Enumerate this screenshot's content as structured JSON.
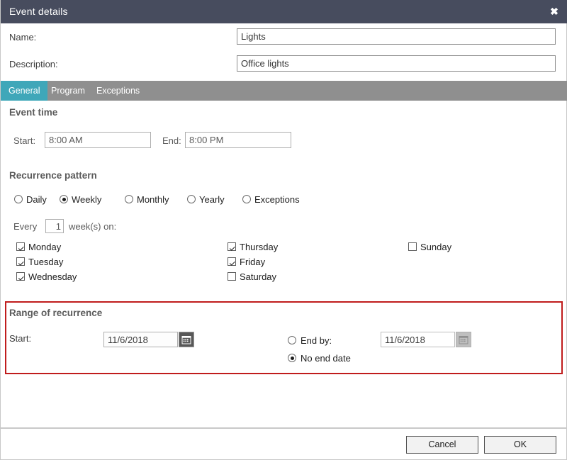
{
  "window": {
    "title": "Event details",
    "close_icon": "close-icon",
    "close_glyph": "✖",
    "header_color": "#474c5e",
    "accent_color": "#3fa7b9",
    "highlight_border_color": "#c01c1c"
  },
  "fields": {
    "name_label": "Name:",
    "name_value": "Lights",
    "name_placeholder": "",
    "description_label": "Description:",
    "description_value": "Office lights",
    "description_placeholder": ""
  },
  "tabs": [
    {
      "label": "General",
      "active": true
    },
    {
      "label": "Program",
      "active": false
    },
    {
      "label": "Exceptions",
      "active": false
    }
  ],
  "event_time": {
    "heading": "Event time",
    "start_label": "Start:",
    "start_value": "8:00 AM",
    "end_label": "End:",
    "end_value": "8:00 PM"
  },
  "recurrence_pattern": {
    "heading": "Recurrence pattern",
    "options": [
      {
        "label": "Daily",
        "selected": false
      },
      {
        "label": "Weekly",
        "selected": true
      },
      {
        "label": "Monthly",
        "selected": false
      },
      {
        "label": "Yearly",
        "selected": false
      },
      {
        "label": "Exceptions",
        "selected": false
      }
    ],
    "every_label": "Every",
    "interval_value": "1",
    "units_label": "week(s) on:",
    "weekdays": [
      {
        "label": "Monday",
        "checked": true
      },
      {
        "label": "Tuesday",
        "checked": true
      },
      {
        "label": "Wednesday",
        "checked": true
      },
      {
        "label": "Thursday",
        "checked": true
      },
      {
        "label": "Friday",
        "checked": true
      },
      {
        "label": "Saturday",
        "checked": false
      },
      {
        "label": "Sunday",
        "checked": false
      }
    ]
  },
  "range_of_recurrence": {
    "heading": "Range of recurrence",
    "start_label": "Start:",
    "start_value": "11/6/2018",
    "start_calendar_icon": "calendar-icon",
    "end_by_label": "End by:",
    "end_by_selected": false,
    "end_by_value": "11/6/2018",
    "end_calendar_icon": "calendar-icon",
    "no_end_date_label": "No end date",
    "no_end_date_selected": true
  },
  "footer": {
    "cancel_label": "Cancel",
    "ok_label": "OK"
  }
}
